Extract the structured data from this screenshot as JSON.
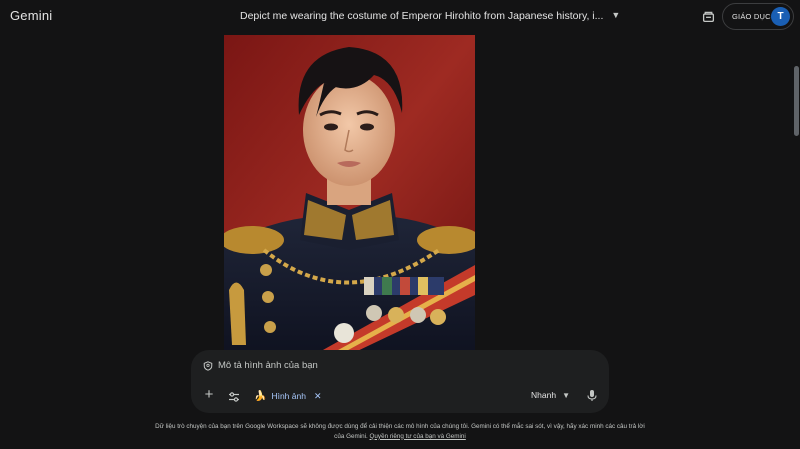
{
  "app": {
    "name": "Gemini"
  },
  "header": {
    "conversation_title": "Depict me wearing the costume of Emperor Hirohito from Japanese history, i...",
    "account_badge": "GIÁO DỤC",
    "avatar_letter": "T"
  },
  "composer": {
    "prompt_label": "Mô tả hình ảnh của bạn",
    "chip_label": "Hình ảnh",
    "mode_label": "Nhanh"
  },
  "footer": {
    "disclaimer_text": "Dữ liệu trò chuyện của bạn trên Google Workspace sẽ không được dùng để cải thiện các mô hình của chúng tôi. Gemini có thể mắc sai sót, vì vậy, hãy xác minh các câu trả lời của Gemini.",
    "privacy_link": "Quyền riêng tư của bạn và Gemini"
  },
  "icons": [
    "chevron-down-icon",
    "apps-icon",
    "shield-icon",
    "plus-icon",
    "tools-icon",
    "banana-icon",
    "close-icon",
    "mic-icon"
  ],
  "colors": {
    "background": "#131314",
    "composer": "#1e1f20",
    "accent": "#a8c7fa",
    "avatar": "#1a5fb4"
  }
}
